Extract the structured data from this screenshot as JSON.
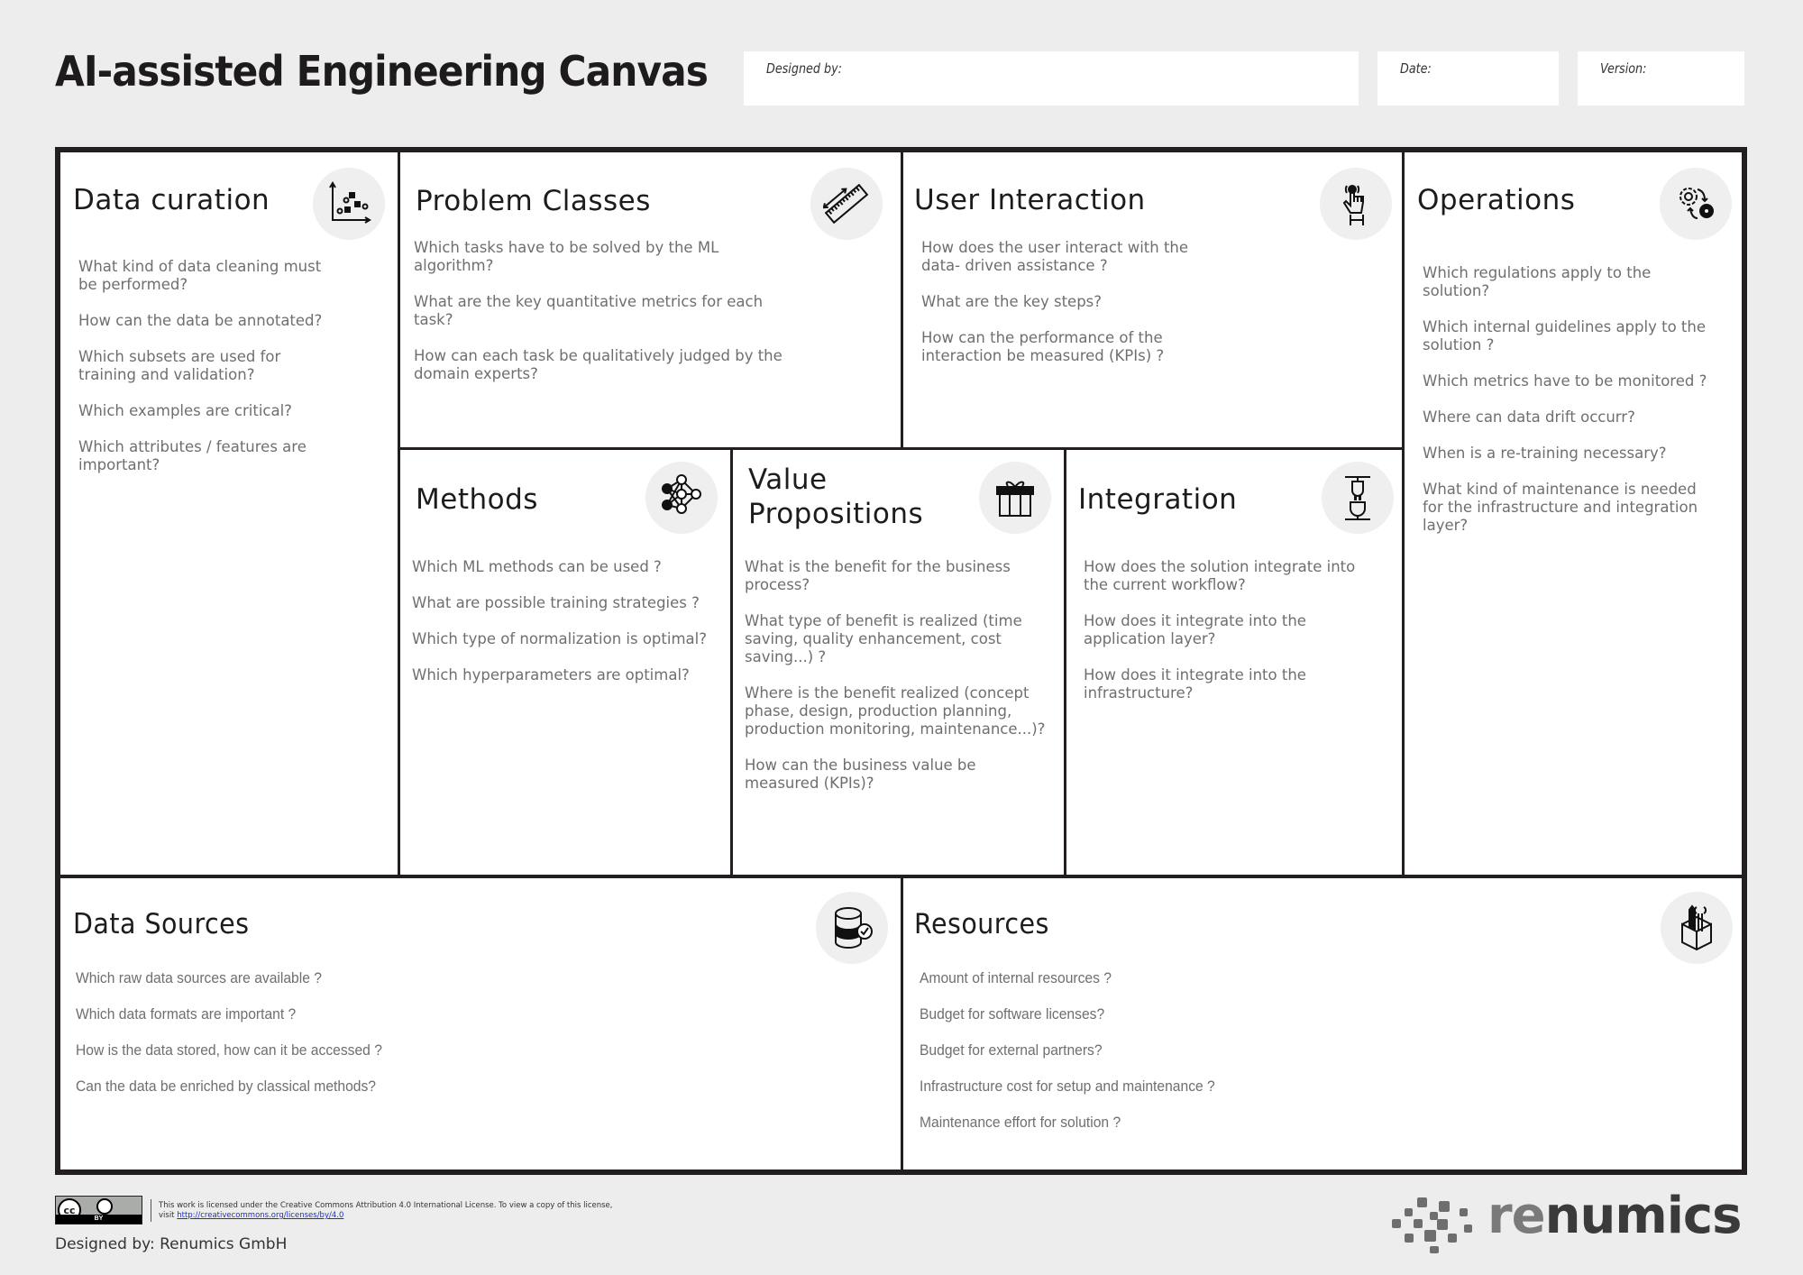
{
  "header": {
    "title": "AI-assisted Engineering Canvas",
    "fields": [
      {
        "label": "Designed by:",
        "value": ""
      },
      {
        "label": "Date:",
        "value": ""
      },
      {
        "label": "Version:",
        "value": ""
      }
    ]
  },
  "sections": {
    "data_curation": {
      "title": "Data curation",
      "icon": "scatter-plot-icon",
      "questions": [
        "What kind of data cleaning must be performed?",
        "How can the data be annotated?",
        "Which subsets are used for training and validation?",
        "Which examples are critical?",
        "Which attributes / features are important?"
      ]
    },
    "problem_classes": {
      "title": "Problem Classes",
      "icon": "ruler-icon",
      "questions": [
        "Which tasks have to be solved by the ML algorithm?",
        "What are the key quantitative metrics for each task?",
        "How can each task be qualitatively judged by the domain experts?"
      ]
    },
    "user_interaction": {
      "title": "User Interaction",
      "icon": "touch-hand-icon",
      "questions": [
        "How does the user interact with the data- driven assistance ?",
        "What are the key steps?",
        "How can the performance of the interaction be measured (KPIs) ?"
      ]
    },
    "operations": {
      "title": "Operations",
      "icon": "gears-cycle-icon",
      "questions": [
        "Which regulations apply to the solution?",
        "Which internal guidelines apply to the solution ?",
        "Which metrics have to be monitored ?",
        "Where can data drift occurr?",
        "When is a re-training necessary?",
        "What kind of maintenance is needed for the infrastructure and integration layer?"
      ]
    },
    "methods": {
      "title": "Methods",
      "icon": "neural-network-icon",
      "questions": [
        "Which ML methods can be used ?",
        "What are possible training strategies ?",
        "Which type of normalization is optimal?",
        "Which hyperparameters are optimal?"
      ]
    },
    "value_propositions": {
      "title_line1": "Value",
      "title_line2": "Propositions",
      "icon": "gift-icon",
      "questions": [
        "What is the benefit for the business process?",
        "What type of benefit is realized (time saving, quality enhancement, cost saving...) ?",
        "Where is the benefit realized (concept phase, design, production planning, production monitoring, maintenance...)?",
        "How can the business value be measured (KPIs)?"
      ]
    },
    "integration": {
      "title": "Integration",
      "icon": "plug-icon",
      "questions": [
        "How does the solution integrate into the current workflow?",
        "How does it integrate into the application layer?",
        "How does it integrate into the infrastructure?"
      ]
    },
    "data_sources": {
      "title": "Data Sources",
      "icon": "database-check-icon",
      "questions": [
        "Which raw data sources are available ?",
        "Which data formats are important ?",
        "How is the data stored, how can it be accessed ?",
        "Can the data be enriched by classical methods?"
      ]
    },
    "resources": {
      "title": "Resources",
      "icon": "toolbox-icon",
      "questions": [
        "Amount of internal resources ?",
        "Budget for software licenses?",
        "Budget for external partners?",
        "Infrastructure cost for setup and maintenance ?",
        "Maintenance effort for solution ?"
      ]
    }
  },
  "footer": {
    "cc_label": "cc",
    "by_label": "BY",
    "license_line1": "This work is licensed under the Creative Commons Attribution 4.0 International License. To view a copy of this license,",
    "license_visit": "visit",
    "license_link": "http://creativecommons.org/licenses/by/4.0",
    "designed_by": "Designed by: Renumics GmbH",
    "logo_re": "re",
    "logo_rest": "numics"
  }
}
